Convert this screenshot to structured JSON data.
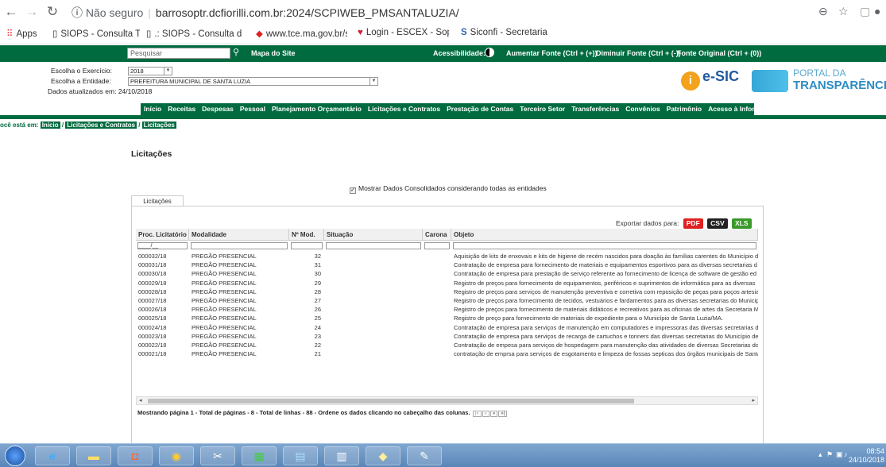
{
  "browser": {
    "url_insecure": "Não seguro",
    "url": "barrosoptr.dcfiorilli.com.br:2024/SCPIWEB_PMSANTALUZIA/",
    "bookmarks": [
      {
        "label": "Apps"
      },
      {
        "label": "SIOPS - Consulta Tra"
      },
      {
        "label": ".: SIOPS - Consulta d"
      },
      {
        "label": "www.tce.ma.gov.br/s"
      },
      {
        "label": "Login - ESCEX - Soph"
      },
      {
        "label": "Siconfi - Secretaria d"
      }
    ]
  },
  "topbar": {
    "search_placeholder": "Pesquisar",
    "sitemap": "Mapa do Site",
    "acess": "Acessibilidade:",
    "font_up": "Aumentar Fonte (Ctrl + (+))",
    "font_down": "Diminuir Fonte (Ctrl + (-))",
    "font_orig": "Fonte Original (Ctrl + (0))"
  },
  "header": {
    "exercicio_label": "Escolha o Exercício:",
    "exercicio_value": "2018",
    "entidade_label": "Escolha a Entidade:",
    "entidade_value": "PREFEITURA MUNICIPAL DE SANTA LUZIA",
    "updated": "Dados atualizados em: 24/10/2018",
    "esic": "e-SIC",
    "portal_1": "PORTAL DA",
    "portal_2": "TRANSPARÊNCIA"
  },
  "menu": [
    "Início",
    "Receitas",
    "Despesas",
    "Pessoal",
    "Planejamento Orçamentário",
    "Licitações e Contratos",
    "Prestação de Contas",
    "Terceiro Setor",
    "Transferências",
    "Convênios",
    "Patrimônio",
    "Acesso à Informação"
  ],
  "breadcrumb": {
    "prefix": "ocê está em:",
    "items": [
      "Início",
      "Licitações e Contratos",
      "Licitações"
    ]
  },
  "page_title": "Licitações",
  "consolidated_label": "Mostrar Dados Consolidados considerando todas as entidades",
  "tab_label": "Licitações",
  "export": {
    "label": "Exportar dados para:",
    "pdf": "PDF",
    "csv": "CSV",
    "xls": "XLS"
  },
  "table": {
    "headers": [
      "Proc. Licitatório",
      "Modalidade",
      "Nº Mod.",
      "Situação",
      "Carona",
      "Objeto"
    ],
    "filter_mask": "____/__",
    "rows": [
      [
        "000032/18",
        "PREGÃO PRESENCIAL",
        "32",
        "",
        "",
        "Aquisição de kits de enxovais e kits de higiene de recém nascidos para doação às famílias carentes do Município d"
      ],
      [
        "000031/18",
        "PREGÃO PRESENCIAL",
        "31",
        "",
        "",
        "Contratação de empresa para fornecimento de materiais e equipamentos esportivos para as diversas secretarias d"
      ],
      [
        "000030/18",
        "PREGÃO PRESENCIAL",
        "30",
        "",
        "",
        "Contratação de empresa para prestação de serviço referente ao fornecimento de licença de software de gestão ed"
      ],
      [
        "000029/18",
        "PREGÃO PRESENCIAL",
        "29",
        "",
        "",
        "Registro de preços para fornecimento de equipamentos, periféricos e suprimentos de informática para as diversas"
      ],
      [
        "000028/18",
        "PREGÃO PRESENCIAL",
        "28",
        "",
        "",
        "Registro de preços para serviços de manutenção preventiva e corretiva com reposição de peças para poços artesia"
      ],
      [
        "000027/18",
        "PREGÃO PRESENCIAL",
        "27",
        "",
        "",
        "Registro de preços para fornecimento de tecidos, vestuários e fardamentos para as diversas secretarias do Municip"
      ],
      [
        "000026/18",
        "PREGÃO PRESENCIAL",
        "26",
        "",
        "",
        "Registro de preços para fornecimento de materiais didáticos e recreativos para as oficinas de artes da Secretaria M"
      ],
      [
        "000025/18",
        "PREGÃO PRESENCIAL",
        "25",
        "",
        "",
        "Registro de preço para fornecimento de materiais de expediente para o Município de Santa Luzia/MA."
      ],
      [
        "000024/18",
        "PREGÃO PRESENCIAL",
        "24",
        "",
        "",
        "Contratação de empresa para serviços de manutenção em computadores e impressoras das diversas secretarias di"
      ],
      [
        "000023/18",
        "PREGÃO PRESENCIAL",
        "23",
        "",
        "",
        "Contratação de empresa para serviços de recarga de cartuchos e tonners das diversas secretarias do Município de"
      ],
      [
        "000022/18",
        "PREGÃO PRESENCIAL",
        "22",
        "",
        "",
        "Contratação de empesa para serviços de hospedagem para manutenção das atividades de diversas Secretarias do"
      ],
      [
        "000021/18",
        "PREGÃO PRESENCIAL",
        "21",
        "",
        "",
        "contratação de emprsa para serviços de esgotamento e limpeza de fossas septicas dos órgãos municipais de Santa"
      ]
    ]
  },
  "footer_info": "Mostrando página 1 - Total de páginas - 8 - Total de linhas - 88 - Ordene os dados clicando no cabeçalho das colunas.",
  "pager": [
    "|«",
    "«",
    "»",
    "»|"
  ],
  "clock": {
    "time": "08:54",
    "date": "24/10/2018"
  },
  "colors": {
    "green": "#006b3f",
    "pdf": "#e02020",
    "csv": "#222222",
    "xls": "#3a9a2a"
  }
}
